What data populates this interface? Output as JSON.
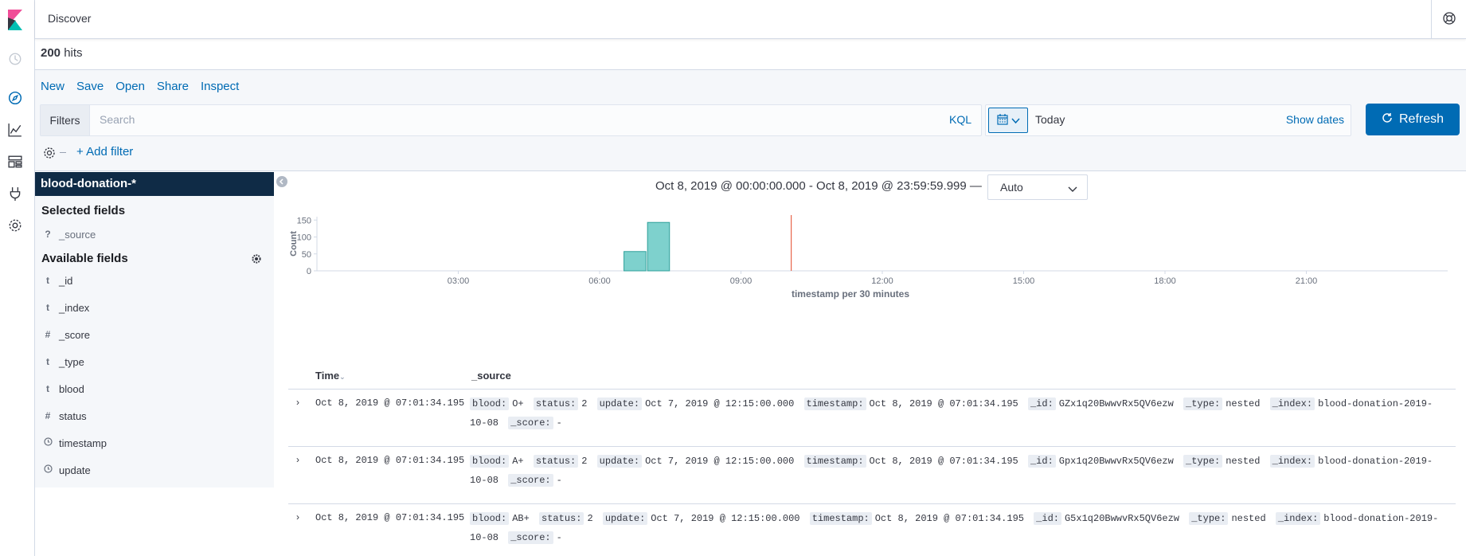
{
  "app": {
    "title": "Discover"
  },
  "hits": {
    "count": "200",
    "label": "hits"
  },
  "top_menu": [
    "New",
    "Save",
    "Open",
    "Share",
    "Inspect"
  ],
  "query": {
    "filters_label": "Filters",
    "placeholder": "Search",
    "language": "KQL",
    "date_value": "Today",
    "show_dates": "Show dates",
    "refresh_label": "Refresh",
    "add_filter": "+ Add filter"
  },
  "sidebar": {
    "index_pattern": "blood-donation-*",
    "selected_title": "Selected fields",
    "selected_fields": [
      {
        "type": "?",
        "name": "_source"
      }
    ],
    "available_title": "Available fields",
    "available_fields": [
      {
        "type": "t",
        "name": "_id"
      },
      {
        "type": "t",
        "name": "_index"
      },
      {
        "type": "#",
        "name": "_score"
      },
      {
        "type": "t",
        "name": "_type"
      },
      {
        "type": "t",
        "name": "blood"
      },
      {
        "type": "#",
        "name": "status"
      },
      {
        "type": "clock",
        "name": "timestamp"
      },
      {
        "type": "clock",
        "name": "update"
      }
    ]
  },
  "chart_header": {
    "range": "Oct 8, 2019 @ 00:00:00.000 - Oct 8, 2019 @ 23:59:59.999 —",
    "interval": "Auto"
  },
  "chart_data": {
    "type": "bar",
    "xlabel": "timestamp per 30 minutes",
    "ylabel": "Count",
    "ylim": [
      0,
      160
    ],
    "yticks": [
      0,
      50,
      100,
      150
    ],
    "x_range_hours": [
      0,
      24
    ],
    "xticks": [
      "03:00",
      "06:00",
      "09:00",
      "12:00",
      "15:00",
      "18:00",
      "21:00"
    ],
    "bars": [
      {
        "start": "06:30",
        "end": "07:00",
        "value": 57
      },
      {
        "start": "07:00",
        "end": "07:30",
        "value": 143
      }
    ],
    "now_marker": "10:04",
    "colors": {
      "bar": "#7ed1cd",
      "bar_stroke": "#2ea09a",
      "now_line": "#e7664c"
    }
  },
  "table": {
    "col_time": "Time",
    "col_source": "_source",
    "rows": [
      {
        "time": "Oct 8, 2019 @ 07:01:34.195",
        "fields": [
          {
            "k": "blood:",
            "v": "O+"
          },
          {
            "k": "status:",
            "v": "2"
          },
          {
            "k": "update:",
            "v": "Oct 7, 2019 @ 12:15:00.000"
          },
          {
            "k": "timestamp:",
            "v": "Oct 8, 2019 @ 07:01:34.195"
          },
          {
            "k": "_id:",
            "v": "GZx1q20BwwvRx5QV6ezw"
          },
          {
            "k": "_type:",
            "v": "nested"
          },
          {
            "k": "_index:",
            "v": "blood-donation-2019-10-08"
          },
          {
            "k": "_score:",
            "v": "-"
          }
        ]
      },
      {
        "time": "Oct 8, 2019 @ 07:01:34.195",
        "fields": [
          {
            "k": "blood:",
            "v": "A+"
          },
          {
            "k": "status:",
            "v": "2"
          },
          {
            "k": "update:",
            "v": "Oct 7, 2019 @ 12:15:00.000"
          },
          {
            "k": "timestamp:",
            "v": "Oct 8, 2019 @ 07:01:34.195"
          },
          {
            "k": "_id:",
            "v": "Gpx1q20BwwvRx5QV6ezw"
          },
          {
            "k": "_type:",
            "v": "nested"
          },
          {
            "k": "_index:",
            "v": "blood-donation-2019-10-08"
          },
          {
            "k": "_score:",
            "v": "-"
          }
        ]
      },
      {
        "time": "Oct 8, 2019 @ 07:01:34.195",
        "fields": [
          {
            "k": "blood:",
            "v": "AB+"
          },
          {
            "k": "status:",
            "v": "2"
          },
          {
            "k": "update:",
            "v": "Oct 7, 2019 @ 12:15:00.000"
          },
          {
            "k": "timestamp:",
            "v": "Oct 8, 2019 @ 07:01:34.195"
          },
          {
            "k": "_id:",
            "v": "G5x1q20BwwvRx5QV6ezw"
          },
          {
            "k": "_type:",
            "v": "nested"
          },
          {
            "k": "_index:",
            "v": "blood-donation-2019-10-08"
          },
          {
            "k": "_score:",
            "v": "-"
          }
        ]
      }
    ]
  },
  "icons": {
    "nav": [
      "recent-icon",
      "discover-icon",
      "visualize-icon",
      "dashboard-icon",
      "dev-tools-icon",
      "management-icon"
    ],
    "help": "help-icon"
  }
}
